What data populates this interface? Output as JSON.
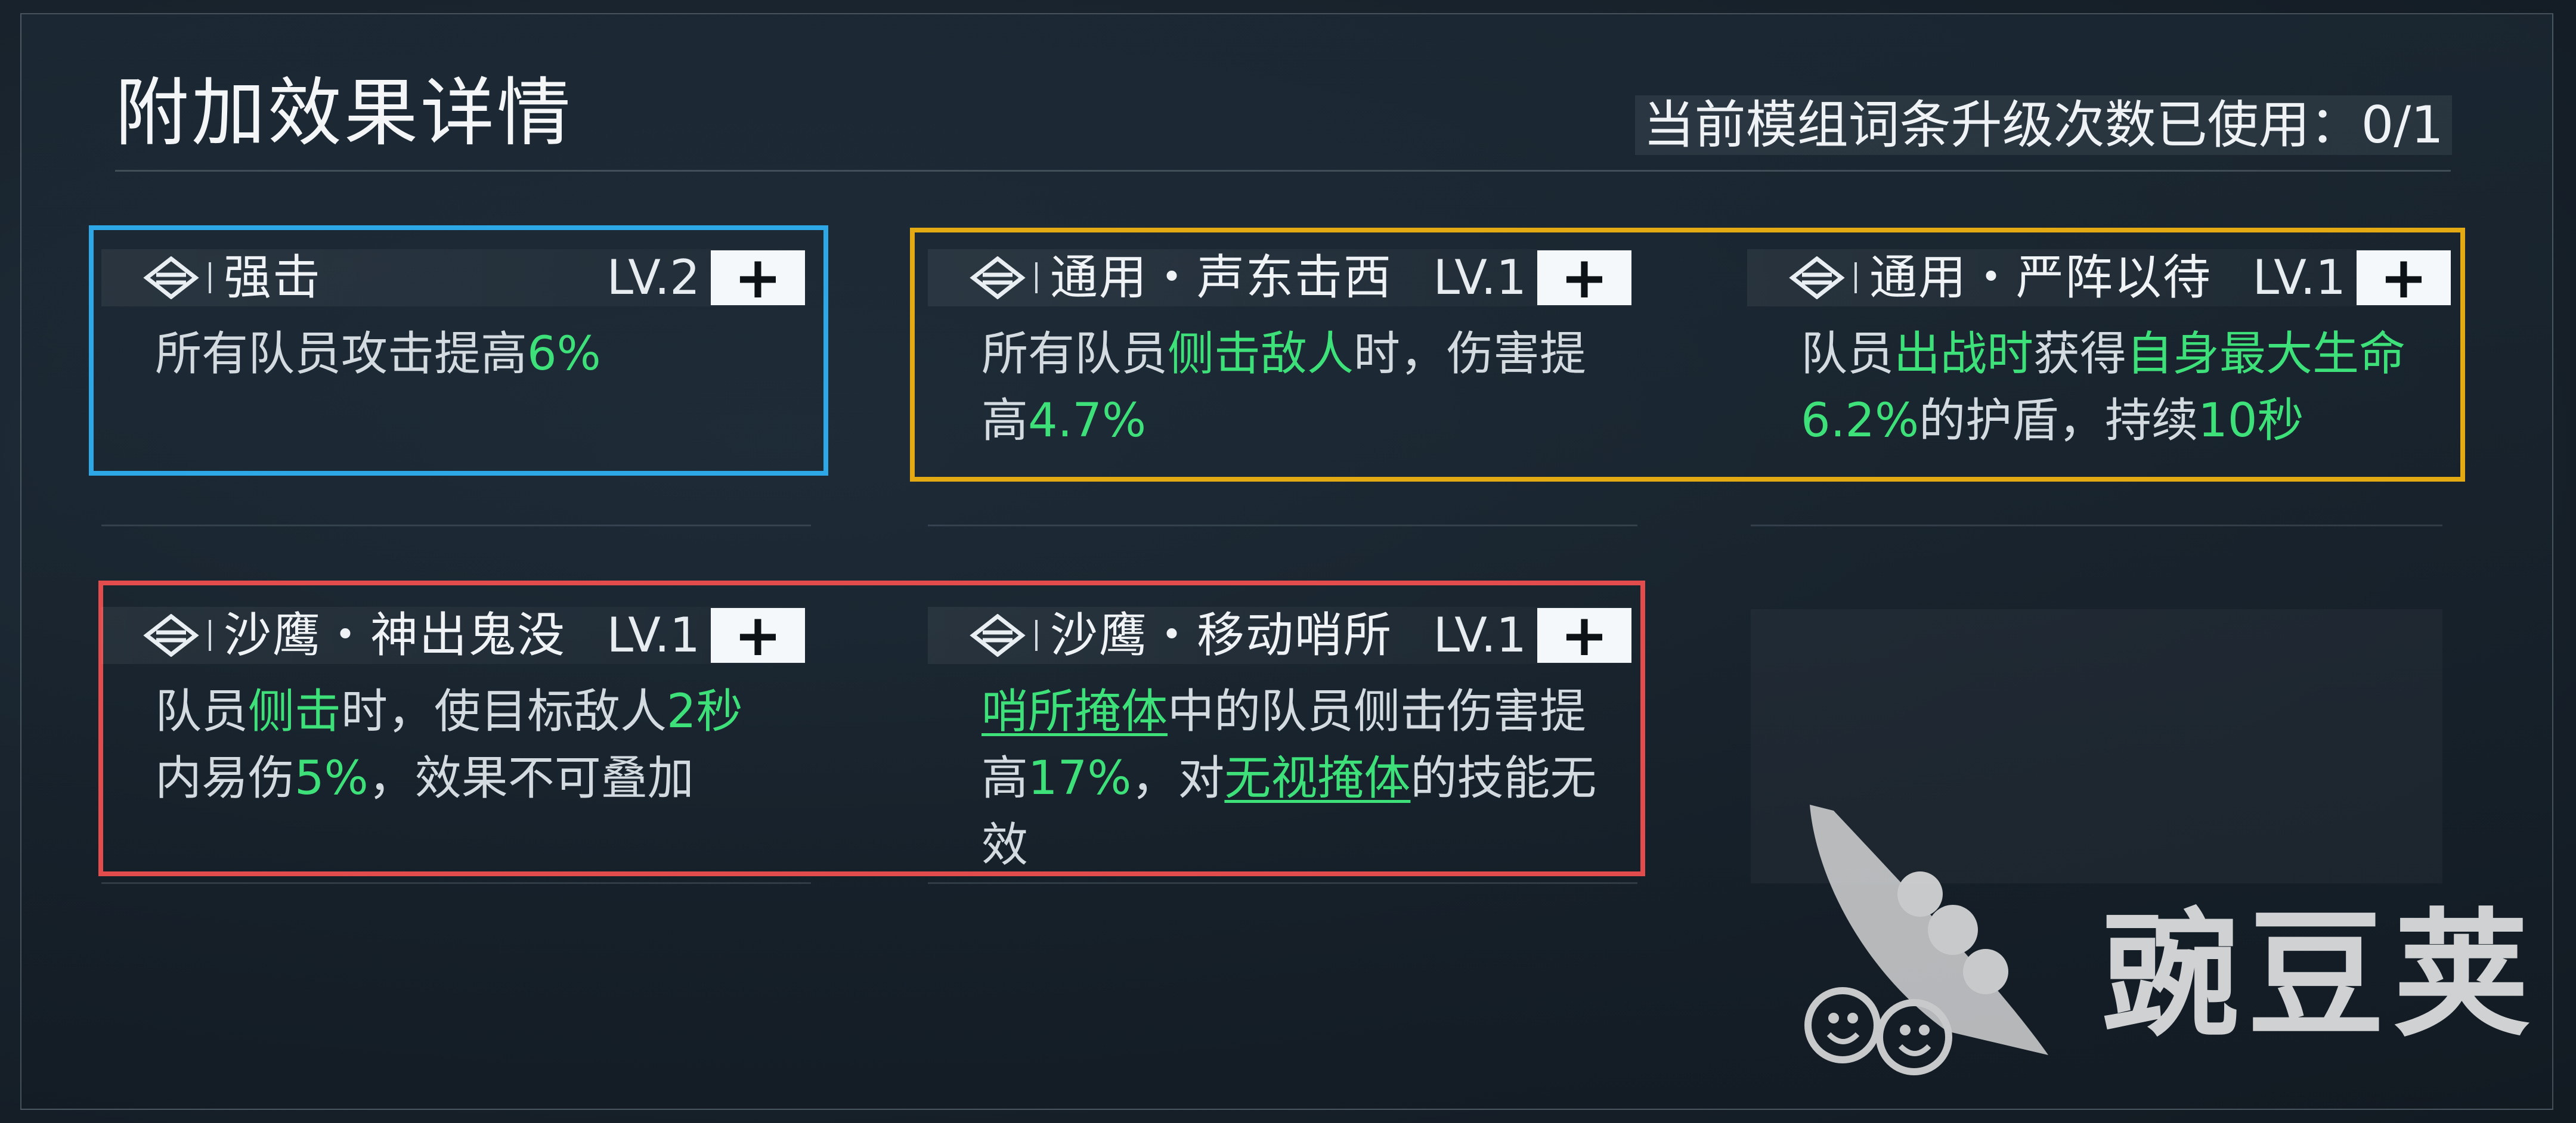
{
  "header": {
    "title": "附加效果详情",
    "upgrade_status": "当前模组词条升级次数已使用：0/1"
  },
  "cards": [
    {
      "name": "强击",
      "level": "LV.2",
      "plus": "+",
      "desc": [
        {
          "t": "所有队员攻击提高"
        },
        {
          "t": "6%",
          "s": "hl"
        }
      ]
    },
    {
      "name": "通用・声东击西",
      "level": "LV.1",
      "plus": "+",
      "desc": [
        {
          "t": "所有队员"
        },
        {
          "t": "侧击敌人",
          "s": "hl"
        },
        {
          "t": "时，伤害提"
        },
        {
          "br": true
        },
        {
          "t": "高"
        },
        {
          "t": "4.7%",
          "s": "hl"
        }
      ]
    },
    {
      "name": "通用・严阵以待",
      "level": "LV.1",
      "plus": "+",
      "desc": [
        {
          "t": "队员"
        },
        {
          "t": "出战时",
          "s": "hl"
        },
        {
          "t": "获得"
        },
        {
          "t": "自身最大生命",
          "s": "hl"
        },
        {
          "br": true
        },
        {
          "t": "6.2%",
          "s": "hl"
        },
        {
          "t": "的护盾，持续"
        },
        {
          "t": "10秒",
          "s": "hl"
        }
      ]
    },
    {
      "name": "沙鹰・神出鬼没",
      "level": "LV.1",
      "plus": "+",
      "desc": [
        {
          "t": "队员"
        },
        {
          "t": "侧击",
          "s": "hl"
        },
        {
          "t": "时，使目标敌人"
        },
        {
          "t": "2秒",
          "s": "hl"
        },
        {
          "br": true
        },
        {
          "t": "内易伤"
        },
        {
          "t": "5%",
          "s": "hl"
        },
        {
          "t": "，效果不可叠加"
        }
      ]
    },
    {
      "name": "沙鹰・移动哨所",
      "level": "LV.1",
      "plus": "+",
      "desc": [
        {
          "t": "哨所掩体",
          "s": "ul"
        },
        {
          "t": "中的队员侧击伤害提"
        },
        {
          "br": true
        },
        {
          "t": "高"
        },
        {
          "t": "17%",
          "s": "hl"
        },
        {
          "t": "，对"
        },
        {
          "t": "无视掩体",
          "s": "ul"
        },
        {
          "t": "的技能无"
        },
        {
          "br": true
        },
        {
          "t": "效"
        }
      ]
    }
  ],
  "watermark": {
    "text": "豌豆荚",
    "icon": "pea-pod-icon"
  },
  "colors": {
    "highlight": "#3ee07a",
    "group_blue": "#2ea7e6",
    "group_gold": "#e4aa14",
    "group_red": "#e24c4c"
  }
}
